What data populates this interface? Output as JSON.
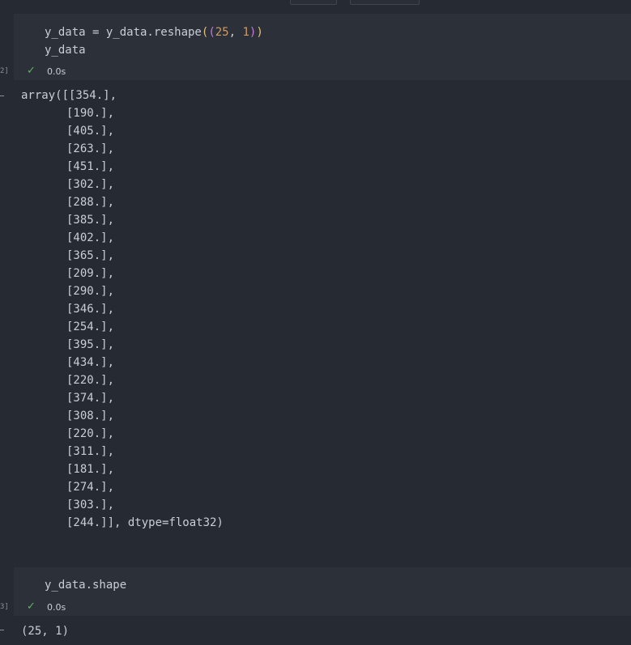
{
  "cell1": {
    "exec_count": "2]",
    "code": {
      "line1_prefix": "y_data = y_data.reshape",
      "line1_open_outer": "(",
      "line1_open_inner": "(",
      "line1_num1": "25",
      "line1_sep": ", ",
      "line1_num2": "1",
      "line1_close_inner": ")",
      "line1_close_outer": ")",
      "line2": "y_data"
    },
    "status_time": "0.0s",
    "output": {
      "first_line": "array([[354.],",
      "rows": [
        "[190.],",
        "[405.],",
        "[263.],",
        "[451.],",
        "[302.],",
        "[288.],",
        "[385.],",
        "[402.],",
        "[365.],",
        "[209.],",
        "[290.],",
        "[346.],",
        "[254.],",
        "[395.],",
        "[434.],",
        "[220.],",
        "[374.],",
        "[308.],",
        "[220.],",
        "[311.],",
        "[181.],",
        "[274.],",
        "[303.],"
      ],
      "last_line": "[244.]], dtype=float32)"
    }
  },
  "cell2": {
    "exec_count": "3]",
    "code": {
      "line1": "y_data.shape"
    },
    "status_time": "0.0s",
    "output": {
      "line1": "(25, 1)"
    }
  },
  "icons": {
    "success": "check-icon"
  },
  "colors": {
    "background": "#262a33",
    "cell_bg": "#2c3039",
    "success": "#5fb35f"
  }
}
